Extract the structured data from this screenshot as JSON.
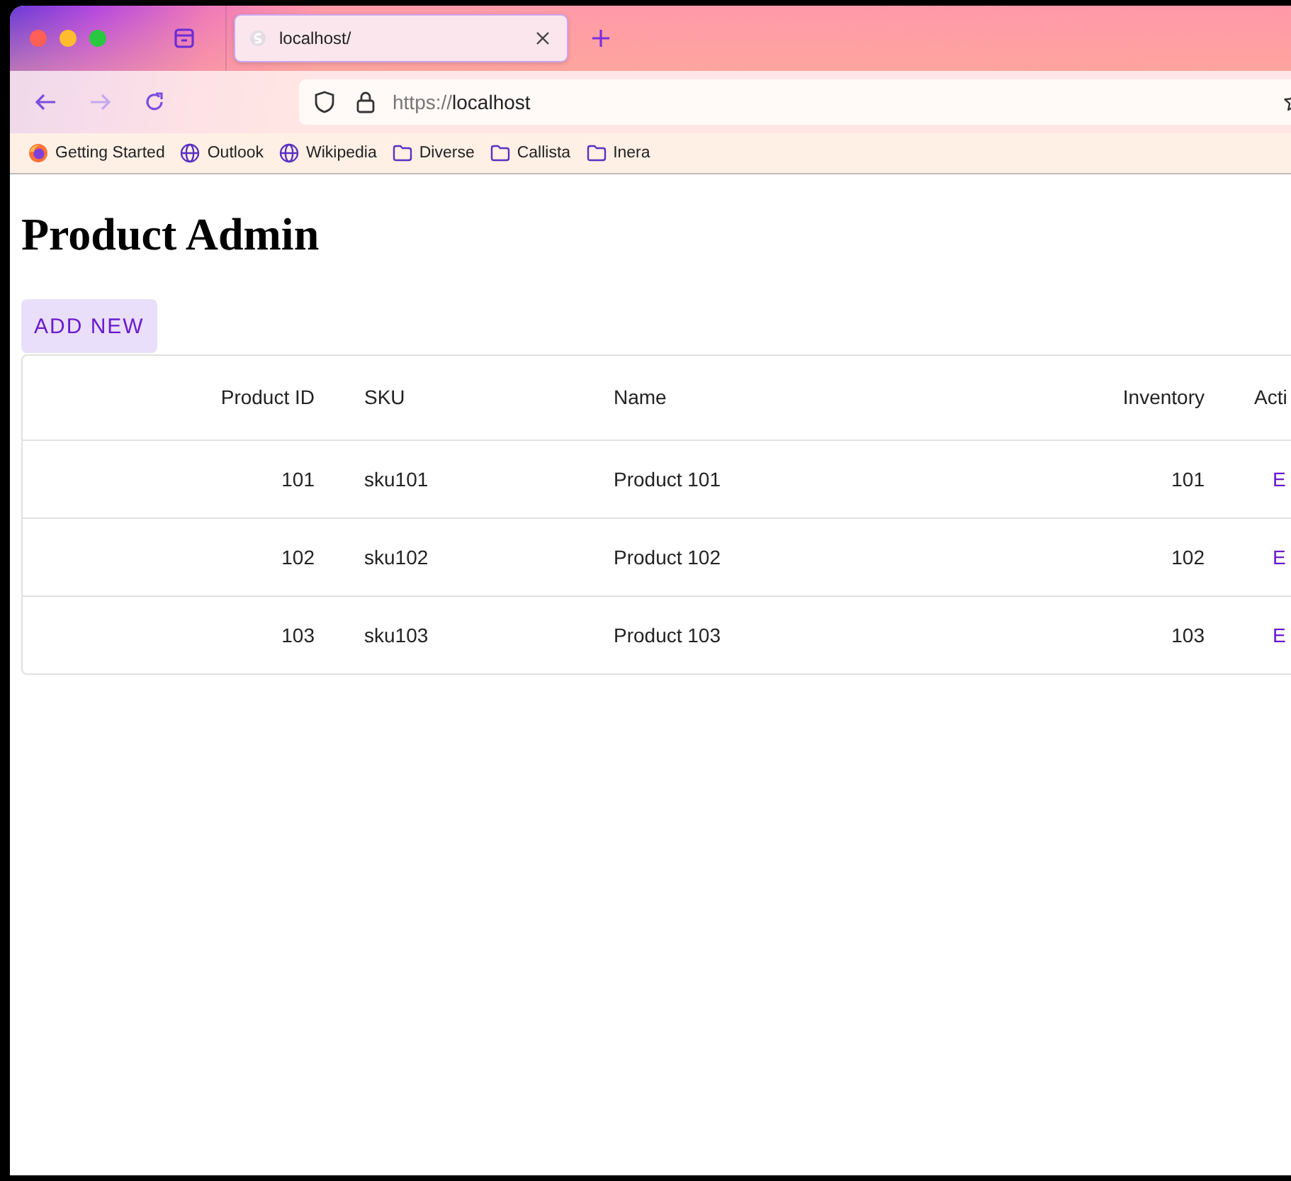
{
  "browser": {
    "tabs": [
      {
        "title": "localhost/",
        "selected": true
      }
    ],
    "address": {
      "scheme": "https://",
      "host": "localhost"
    },
    "bookmarks": [
      {
        "label": "Getting Started",
        "kind": "firefox"
      },
      {
        "label": "Outlook",
        "kind": "globe"
      },
      {
        "label": "Wikipedia",
        "kind": "globe"
      },
      {
        "label": "Diverse",
        "kind": "folder"
      },
      {
        "label": "Callista",
        "kind": "folder"
      },
      {
        "label": "Inera",
        "kind": "folder"
      }
    ]
  },
  "page": {
    "title": "Product Admin",
    "add_button": "ADD NEW",
    "table": {
      "columns": [
        {
          "label": "Product ID",
          "kind": "number"
        },
        {
          "label": "SKU",
          "kind": "text"
        },
        {
          "label": "Name",
          "kind": "text"
        },
        {
          "label": "Inventory",
          "kind": "number"
        },
        {
          "label": "Acti",
          "kind": "action"
        }
      ],
      "rows": [
        {
          "cells": [
            "101",
            "sku101",
            "Product 101",
            "101",
            "E"
          ]
        },
        {
          "cells": [
            "102",
            "sku102",
            "Product 102",
            "102",
            "E"
          ]
        },
        {
          "cells": [
            "103",
            "sku103",
            "Product 103",
            "103",
            "E"
          ]
        }
      ]
    }
  }
}
